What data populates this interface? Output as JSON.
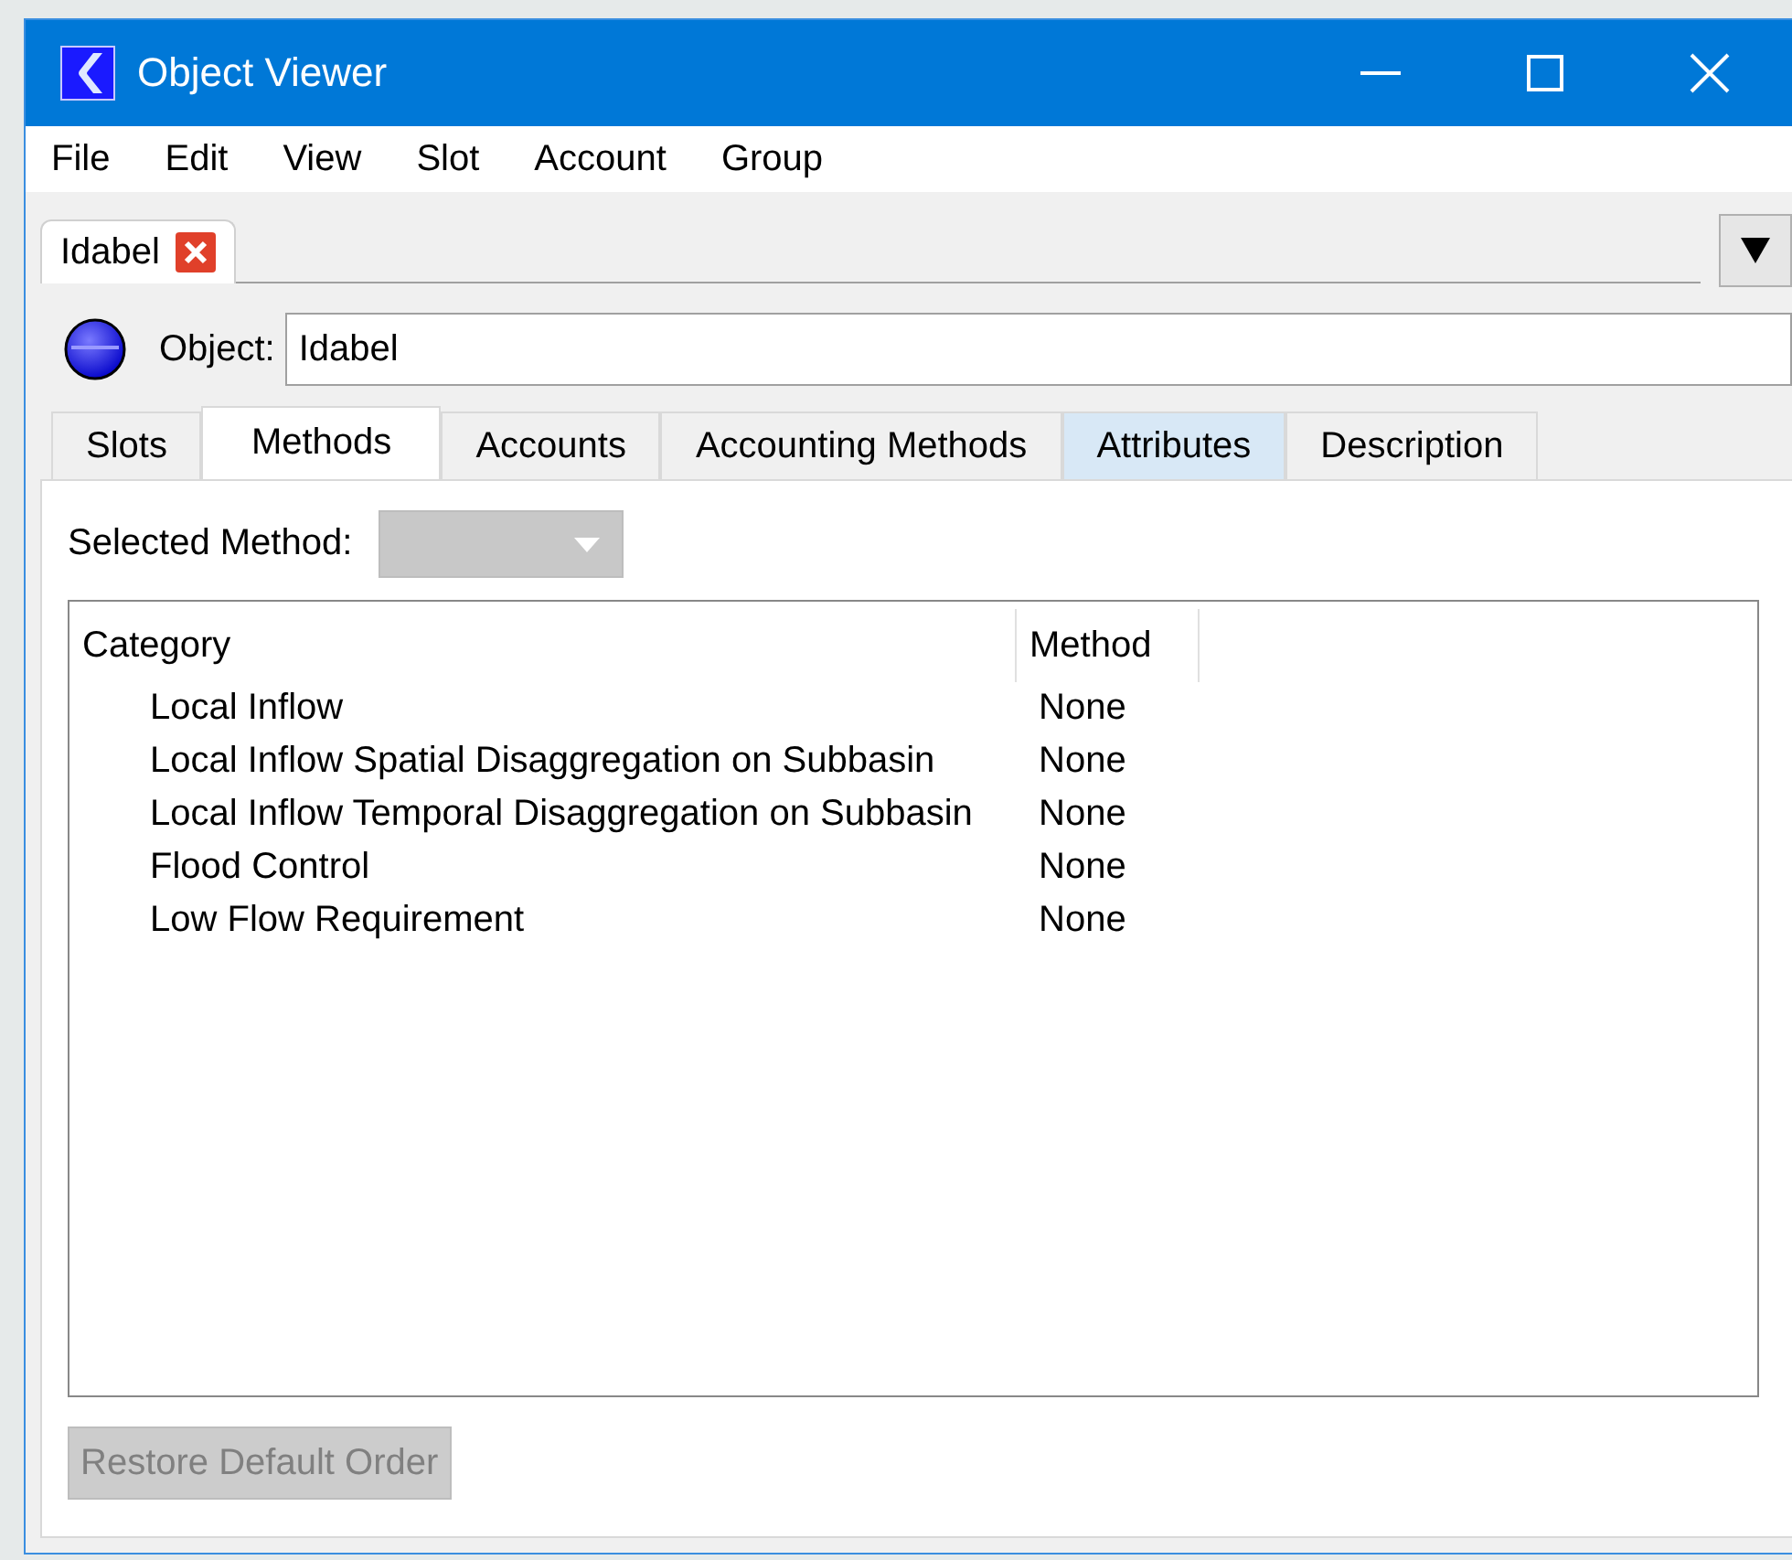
{
  "window": {
    "title": "Object Viewer"
  },
  "menu": [
    "File",
    "Edit",
    "View",
    "Slot",
    "Account",
    "Group"
  ],
  "document_tabs": [
    {
      "label": "Idabel",
      "selected": true
    }
  ],
  "object": {
    "label": "Object:",
    "value": "Idabel"
  },
  "tabs": [
    {
      "label": "Slots",
      "selected": false,
      "hovered": false
    },
    {
      "label": "Methods",
      "selected": true,
      "hovered": false
    },
    {
      "label": "Accounts",
      "selected": false,
      "hovered": false
    },
    {
      "label": "Accounting Methods",
      "selected": false,
      "hovered": false
    },
    {
      "label": "Attributes",
      "selected": false,
      "hovered": true
    },
    {
      "label": "Description",
      "selected": false,
      "hovered": false
    }
  ],
  "selected_method": {
    "label": "Selected Method:",
    "disabled": true
  },
  "table": {
    "columns": [
      "Category",
      "Method"
    ],
    "rows": [
      {
        "category": "Local Inflow",
        "method": "None"
      },
      {
        "category": "Local Inflow Spatial Disaggregation on Subbasin",
        "method": "None"
      },
      {
        "category": "Local Inflow Temporal Disaggregation on Subbasin",
        "method": "None"
      },
      {
        "category": "Flood Control",
        "method": "None"
      },
      {
        "category": "Low Flow Requirement",
        "method": "None"
      }
    ]
  },
  "button": {
    "label": "Restore Default Order",
    "disabled": true
  }
}
